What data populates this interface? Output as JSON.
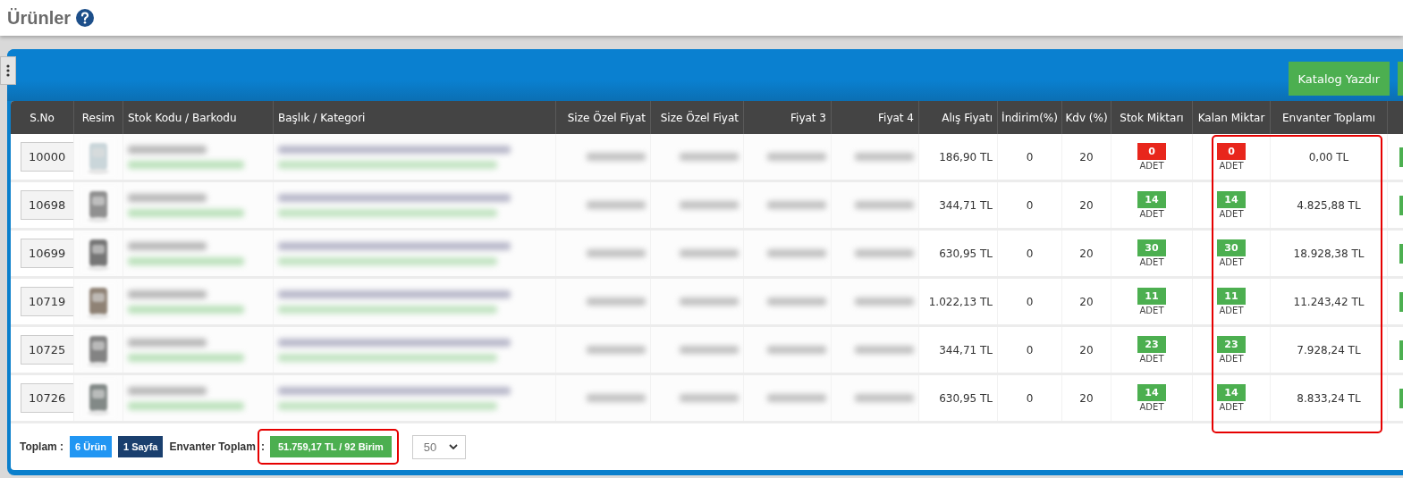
{
  "page": {
    "title": "Ürünler"
  },
  "toolbar": {
    "buttons": [
      "Katalog Yazdır"
    ]
  },
  "table": {
    "columns": [
      "S.No",
      "Resim",
      "Stok Kodu / Barkodu",
      "Başlık / Kategori",
      "Size Özel Fiyat",
      "Size Özel Fiyat",
      "Fiyat 3",
      "Fiyat 4",
      "Alış Fiyatı",
      "İndirim(%)",
      "Kdv (%)",
      "Stok Miktarı",
      "Kalan Miktar",
      "Envanter Toplamı"
    ],
    "rows": [
      {
        "s_no": "10000",
        "alis_fiyati": "186,90 TL",
        "indirim": "0",
        "kdv": "20",
        "stok_miktari": {
          "value": "0",
          "unit": "ADET",
          "color": "#e8261c"
        },
        "kalan_miktar": {
          "value": "0",
          "unit": "ADET",
          "color": "#e8261c"
        },
        "envanter_toplami": "0,00 TL"
      },
      {
        "s_no": "10698",
        "alis_fiyati": "344,71 TL",
        "indirim": "0",
        "kdv": "20",
        "stok_miktari": {
          "value": "14",
          "unit": "ADET",
          "color": "#4caf50"
        },
        "kalan_miktar": {
          "value": "14",
          "unit": "ADET",
          "color": "#4caf50"
        },
        "envanter_toplami": "4.825,88 TL"
      },
      {
        "s_no": "10699",
        "alis_fiyati": "630,95 TL",
        "indirim": "0",
        "kdv": "20",
        "stok_miktari": {
          "value": "30",
          "unit": "ADET",
          "color": "#4caf50"
        },
        "kalan_miktar": {
          "value": "30",
          "unit": "ADET",
          "color": "#4caf50"
        },
        "envanter_toplami": "18.928,38 TL"
      },
      {
        "s_no": "10719",
        "alis_fiyati": "1.022,13 TL",
        "indirim": "0",
        "kdv": "20",
        "stok_miktari": {
          "value": "11",
          "unit": "ADET",
          "color": "#4caf50"
        },
        "kalan_miktar": {
          "value": "11",
          "unit": "ADET",
          "color": "#4caf50"
        },
        "envanter_toplami": "11.243,42 TL"
      },
      {
        "s_no": "10725",
        "alis_fiyati": "344,71 TL",
        "indirim": "0",
        "kdv": "20",
        "stok_miktari": {
          "value": "23",
          "unit": "ADET",
          "color": "#4caf50"
        },
        "kalan_miktar": {
          "value": "23",
          "unit": "ADET",
          "color": "#4caf50"
        },
        "envanter_toplami": "7.928,24 TL"
      },
      {
        "s_no": "10726",
        "alis_fiyati": "630,95 TL",
        "indirim": "0",
        "kdv": "20",
        "stok_miktari": {
          "value": "14",
          "unit": "ADET",
          "color": "#4caf50"
        },
        "kalan_miktar": {
          "value": "14",
          "unit": "ADET",
          "color": "#4caf50"
        },
        "envanter_toplami": "8.833,24 TL"
      }
    ]
  },
  "footer": {
    "label": "Toplam :",
    "count": "6 Ürün",
    "pages": "1 Sayfa",
    "inventory_label": "Envanter Toplam",
    "separator": ":",
    "inventory_total": "51.759,17 TL / 92 Birim",
    "page_size": "50"
  }
}
